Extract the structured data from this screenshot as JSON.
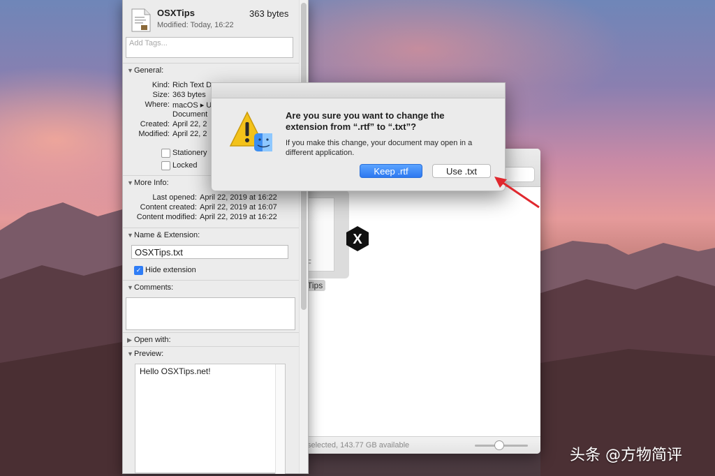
{
  "info": {
    "name": "OSXTips",
    "size": "363 bytes",
    "modified": "Modified: Today, 16:22",
    "tags_placeholder": "Add Tags...",
    "general": {
      "header": "General:",
      "kind_label": "Kind:",
      "kind_value": "Rich Text D",
      "size_label": "Size:",
      "size_value": "363 bytes",
      "where_label": "Where:",
      "where_value": "macOS ▸ U",
      "where_value2": "Document",
      "created_label": "Created:",
      "created_value": "April 22, 2",
      "modified_label": "Modified:",
      "modified_value": "April 22, 2",
      "stationery": "Stationery",
      "locked": "Locked"
    },
    "more_info": {
      "header": "More Info:",
      "last_opened_label": "Last opened:",
      "last_opened_value": "April 22, 2019 at 16:22",
      "content_created_label": "Content created:",
      "content_created_value": "April 22, 2019 at 16:07",
      "content_modified_label": "Content modified:",
      "content_modified_value": "April 22, 2019 at 16:22"
    },
    "name_ext": {
      "header": "Name & Extension:",
      "value": "OSXTips.txt",
      "hide_extension": "Hide extension",
      "hide_checked": true
    },
    "comments_header": "Comments:",
    "open_with_header": "Open with:",
    "preview_header": "Preview:",
    "preview_text": "Hello OSXTips.net!"
  },
  "finder": {
    "file_label": "Tips",
    "ghost_text": "TF",
    "status": "selected, 143.77 GB available",
    "badge": "X"
  },
  "dialog": {
    "title": "Are you sure you want to change the extension from “.rtf” to “.txt”?",
    "message": "If you make this change, your document may open in a different application.",
    "keep_label": "Keep .rtf",
    "use_label": "Use .txt"
  },
  "watermark": "头条 @方物简评",
  "colors": {
    "accent": "#2f7df6",
    "arrow": "#e0282e"
  },
  "icons": [
    "document-icon",
    "warning-icon",
    "finder-icon",
    "disclosure-triangle-icon",
    "x-badge-icon",
    "arrow-icon"
  ]
}
